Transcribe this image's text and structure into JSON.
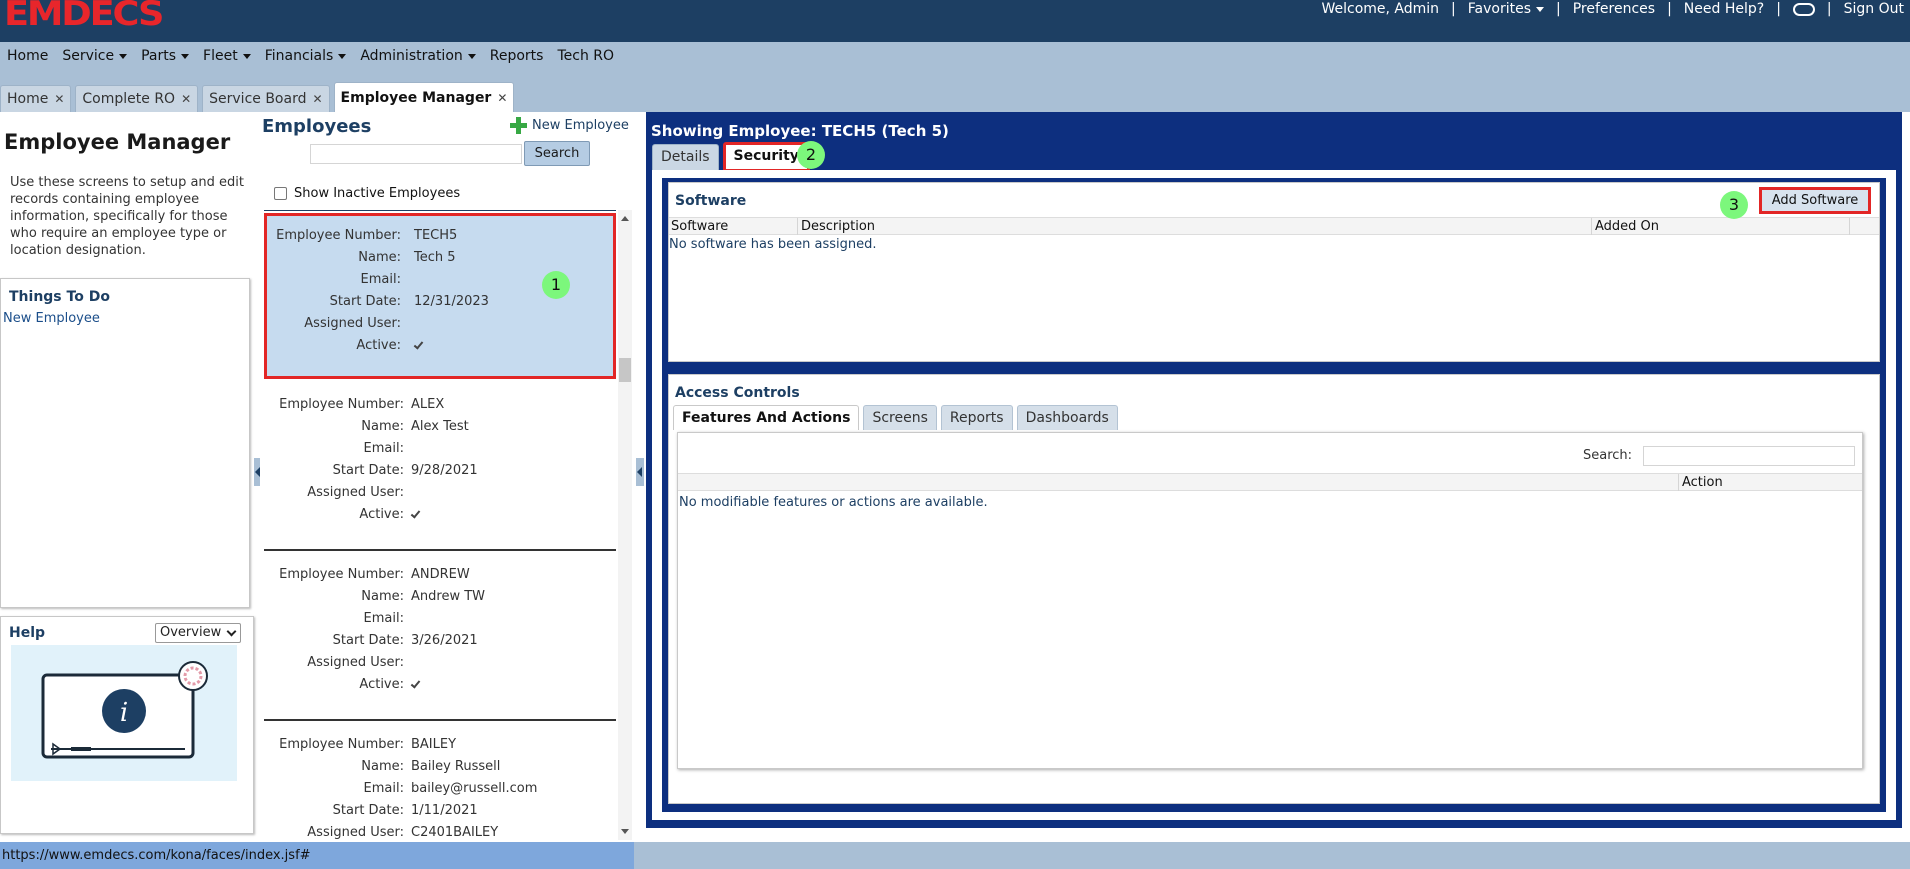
{
  "app": {
    "logo": "EMDECS"
  },
  "topbar": {
    "welcome": "Welcome, Admin",
    "favorites": "Favorites",
    "preferences": "Preferences",
    "need_help": "Need Help?",
    "sign_out": "Sign Out"
  },
  "menu": [
    "Home",
    "Service",
    "Parts",
    "Fleet",
    "Financials",
    "Administration",
    "Reports",
    "Tech RO"
  ],
  "tabs": [
    "Home",
    "Complete RO",
    "Service Board",
    "Employee Manager"
  ],
  "left_panel": {
    "title": "Employee Manager",
    "description": "Use these screens to setup and edit records containing employee information, specifically for those who require an employee type or location designation.",
    "things_to_do_title": "Things To Do",
    "things_to_do_link": "New Employee",
    "help_title": "Help",
    "help_select": "Overview"
  },
  "employees": {
    "title": "Employees",
    "new_employee": "New Employee",
    "search_button": "Search",
    "show_inactive": "Show Inactive Employees",
    "labels": {
      "number": "Employee Number:",
      "name": "Name:",
      "email": "Email:",
      "start": "Start Date:",
      "user": "Assigned User:",
      "active": "Active:"
    },
    "list": [
      {
        "number": "TECH5",
        "name": "Tech 5",
        "email": "",
        "start": "12/31/2023",
        "user": "",
        "active": true
      },
      {
        "number": "ALEX",
        "name": "Alex Test",
        "email": "",
        "start": "9/28/2021",
        "user": "",
        "active": true
      },
      {
        "number": "ANDREW",
        "name": "Andrew TW",
        "email": "",
        "start": "3/26/2021",
        "user": "",
        "active": true
      },
      {
        "number": "BAILEY",
        "name": "Bailey Russell",
        "email": "bailey@russell.com",
        "start": "1/11/2021",
        "user": "C2401BAILEY",
        "active": true
      }
    ]
  },
  "detail": {
    "title": "Showing Employee: TECH5 (Tech 5)",
    "tabs": [
      "Details",
      "Security"
    ],
    "software": {
      "title": "Software",
      "add_button": "Add Software",
      "columns": [
        "Software",
        "Description",
        "Added On"
      ],
      "empty": "No software has been assigned."
    },
    "access": {
      "title": "Access Controls",
      "tabs": [
        "Features And Actions",
        "Screens",
        "Reports",
        "Dashboards"
      ],
      "search_label": "Search:",
      "column_action": "Action",
      "empty": "No modifiable features or actions are available."
    }
  },
  "annotations": [
    "1",
    "2",
    "3"
  ],
  "status_url": "https://www.emdecs.com/kona/faces/index.jsf#",
  "colors": {
    "topbar": "#1d3f63",
    "nav": "#a9bfd5",
    "detail_panel": "#0d2f7f",
    "selected_card": "#c6dbef",
    "highlight": "#e22626",
    "badge": "#7cf77c",
    "logo": "#e8262b"
  }
}
